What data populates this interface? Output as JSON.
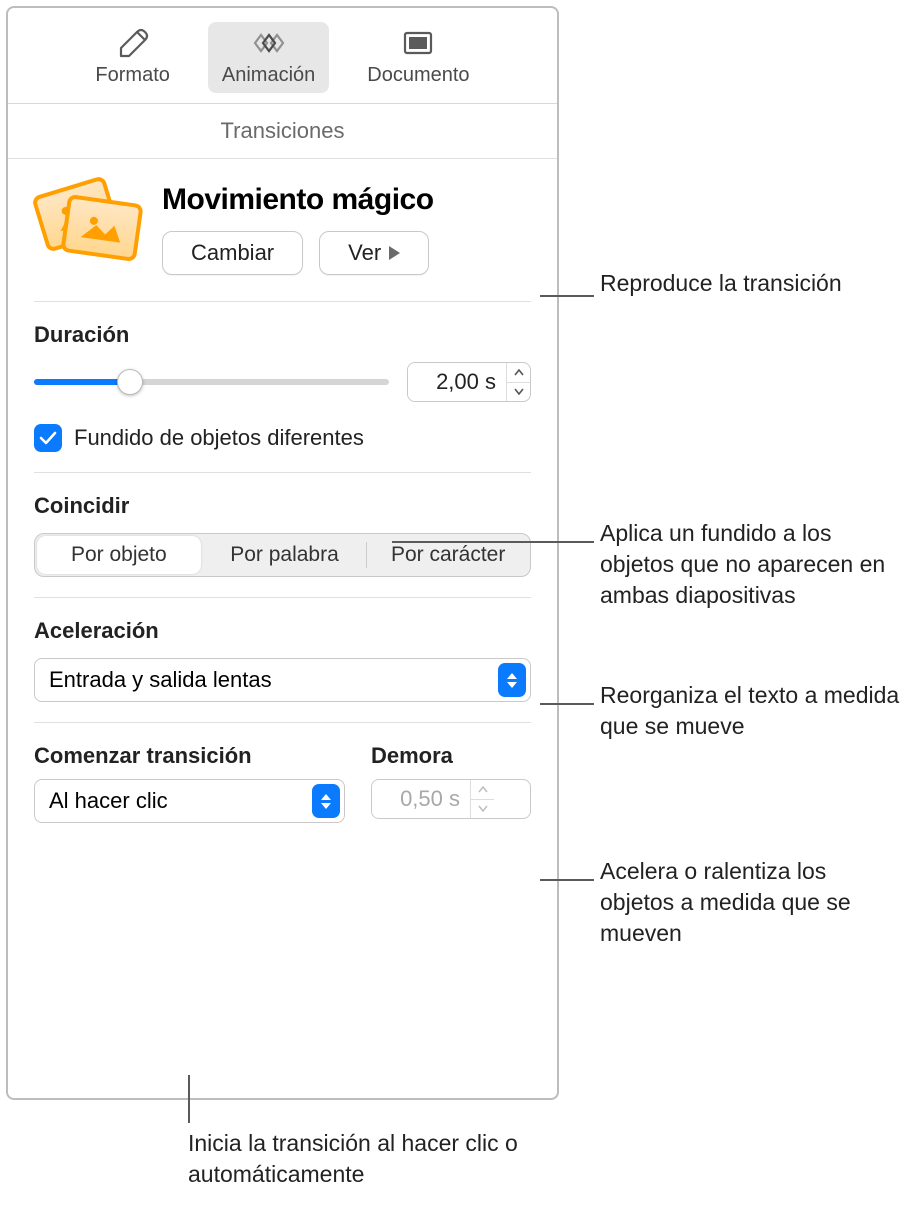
{
  "toolbar": {
    "format": "Formato",
    "animation": "Animación",
    "document": "Documento"
  },
  "section_title": "Transiciones",
  "transition_name": "Movimiento mágico",
  "buttons": {
    "change": "Cambiar",
    "preview": "Ver"
  },
  "duration": {
    "label": "Duración",
    "value": "2,00 s"
  },
  "fade_checkbox": {
    "label": "Fundido de objetos diferentes",
    "checked": true
  },
  "match": {
    "label": "Coincidir",
    "options": [
      "Por objeto",
      "Por palabra",
      "Por carácter"
    ],
    "selected": 0
  },
  "acceleration": {
    "label": "Aceleración",
    "value": "Entrada y salida lentas"
  },
  "start": {
    "label": "Comenzar transición",
    "value": "Al hacer clic"
  },
  "delay": {
    "label": "Demora",
    "value": "0,50 s"
  },
  "callouts": {
    "preview": "Reproduce la transición",
    "fade": "Aplica un fundido a los objetos que no aparecen en ambas diapositivas",
    "match": "Reorganiza el texto a medida que se mueve",
    "accel": "Acelera o ralentiza los objetos a medida que se mueven",
    "start": "Inicia la transición al hacer clic o automáticamente"
  }
}
